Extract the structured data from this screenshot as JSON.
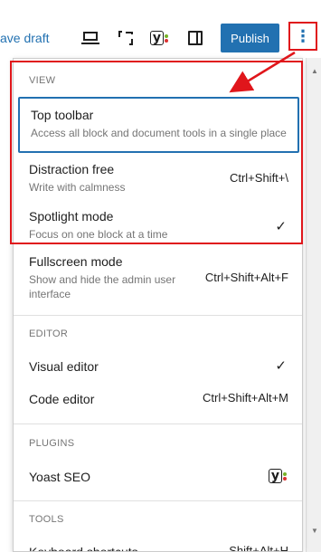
{
  "toolbar": {
    "save_draft": "ave draft",
    "publish": "Publish",
    "more_icon": "⋮"
  },
  "menu": {
    "view": {
      "title": "VIEW",
      "items": [
        {
          "label": "Top toolbar",
          "desc": "Access all block and document tools in a single place"
        },
        {
          "label": "Distraction free",
          "desc": "Write with calmness",
          "shortcut": "Ctrl+Shift+\\"
        },
        {
          "label": "Spotlight mode",
          "desc": "Focus on one block at a time",
          "check": "✓"
        },
        {
          "label": "Fullscreen mode",
          "desc": "Show and hide the admin user interface",
          "shortcut": "Ctrl+Shift+Alt+F"
        }
      ]
    },
    "editor": {
      "title": "EDITOR",
      "items": [
        {
          "label": "Visual editor",
          "check": "✓"
        },
        {
          "label": "Code editor",
          "shortcut": "Ctrl+Shift+Alt+M"
        }
      ]
    },
    "plugins": {
      "title": "PLUGINS",
      "items": [
        {
          "label": "Yoast SEO",
          "icon": "yoast-icon"
        }
      ]
    },
    "tools": {
      "title": "TOOLS",
      "items": [
        {
          "label": "Keyboard shortcuts",
          "shortcut": "Shift+Alt+H"
        }
      ]
    }
  },
  "icons": {
    "yoast_glyph": "y"
  },
  "colors": {
    "accent": "#2271b1",
    "annotation": "#e0161b",
    "yoast_green": "#77b227",
    "yoast_red": "#dc3232"
  }
}
